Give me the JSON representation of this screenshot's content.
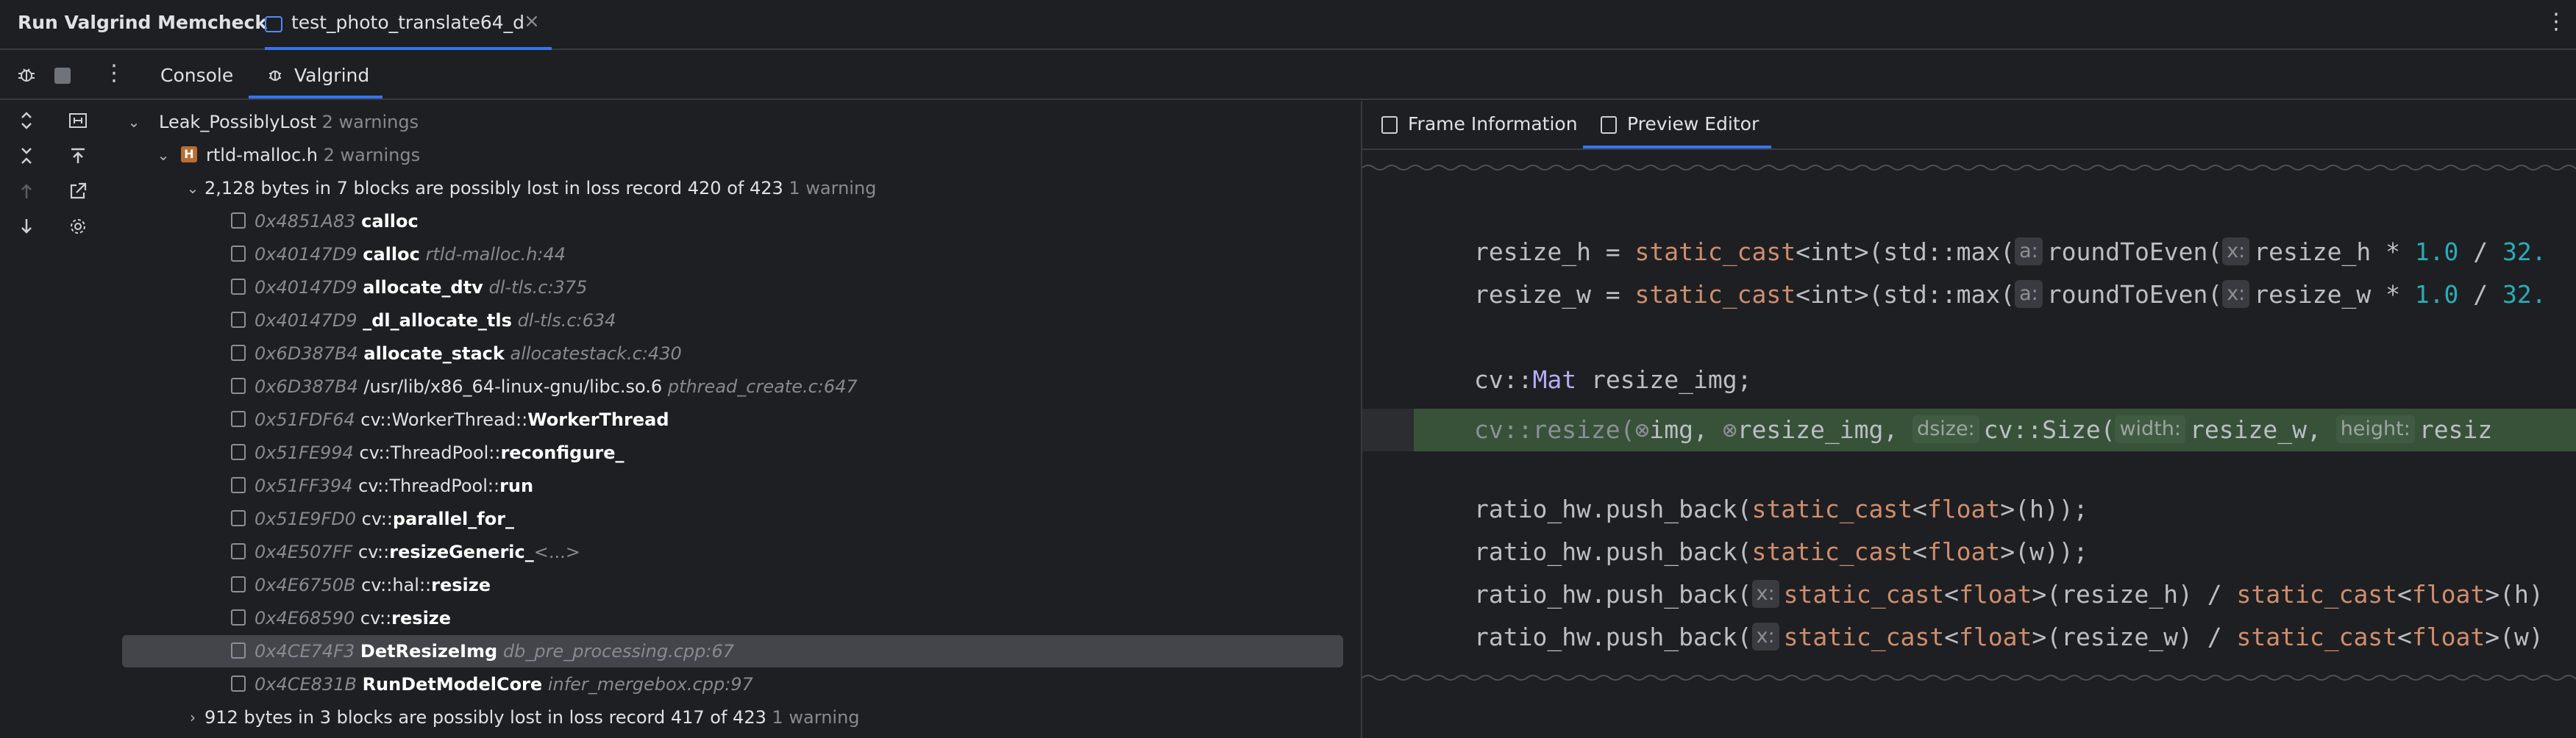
{
  "header": {
    "run_title": "Run Valgrind Memcheck",
    "file_tab": "test_photo_translate64_d",
    "close": "×",
    "more": "⋮"
  },
  "toolbar": {
    "console_tab": "Console",
    "valgrind_tab": "Valgrind",
    "more": "⋮"
  },
  "tree": {
    "leak": {
      "label": "Leak_PossiblyLost",
      "count": "2 warnings"
    },
    "file": {
      "label": "rtld-malloc.h",
      "count": "2 warnings"
    },
    "record1": {
      "label": "2,128 bytes in 7 blocks are possibly lost in loss record 420 of 423",
      "count": "1 warning"
    },
    "frames": [
      {
        "addr": "0x4851A83",
        "pre": "",
        "fn": "calloc",
        "post": "",
        "loc": ""
      },
      {
        "addr": "0x40147D9",
        "pre": "",
        "fn": "calloc",
        "post": "",
        "loc": "rtld-malloc.h:44"
      },
      {
        "addr": "0x40147D9",
        "pre": "",
        "fn": "allocate_dtv",
        "post": "",
        "loc": "dl-tls.c:375"
      },
      {
        "addr": "0x40147D9",
        "pre": "",
        "fn": "_dl_allocate_tls",
        "post": "",
        "loc": "dl-tls.c:634"
      },
      {
        "addr": "0x6D387B4",
        "pre": "",
        "fn": "allocate_stack",
        "post": "",
        "loc": "allocatestack.c:430"
      },
      {
        "addr": "0x6D387B4",
        "pre": "/usr/lib/x86_64-linux-gnu/libc.so.6",
        "fn": "",
        "post": "",
        "loc": "pthread_create.c:647"
      },
      {
        "addr": "0x51FDF64",
        "pre": "cv::WorkerThread::",
        "fn": "WorkerThread",
        "post": "",
        "loc": ""
      },
      {
        "addr": "0x51FE994",
        "pre": "cv::ThreadPool::",
        "fn": "reconfigure_",
        "post": "",
        "loc": ""
      },
      {
        "addr": "0x51FF394",
        "pre": "cv::ThreadPool::",
        "fn": "run",
        "post": "",
        "loc": ""
      },
      {
        "addr": "0x51E9FD0",
        "pre": "cv::",
        "fn": "parallel_for_",
        "post": "",
        "loc": ""
      },
      {
        "addr": "0x4E507FF",
        "pre": "cv::",
        "fn": "resizeGeneric_",
        "post": "<...>",
        "loc": ""
      },
      {
        "addr": "0x4E6750B",
        "pre": "cv::hal::",
        "fn": "resize",
        "post": "",
        "loc": ""
      },
      {
        "addr": "0x4E68590",
        "pre": "cv::",
        "fn": "resize",
        "post": "",
        "loc": ""
      },
      {
        "addr": "0x4CE74F3",
        "pre": "",
        "fn": "DetResizeImg",
        "post": "",
        "loc": "db_pre_processing.cpp:67"
      },
      {
        "addr": "0x4CE831B",
        "pre": "",
        "fn": "RunDetModelCore",
        "post": "",
        "loc": "infer_mergebox.cpp:97"
      }
    ],
    "record2": {
      "label": "912 bytes in 3 blocks are possibly lost in loss record 417 of 423",
      "count": "1 warning"
    }
  },
  "right": {
    "frame_tab": "Frame Information",
    "preview_tab": "Preview Editor"
  },
  "code": {
    "l1": {
      "a": "resize_h = ",
      "b": "static_cast",
      "c": "<int>(std::max(",
      "h1": "a:",
      "d": "roundToEven(",
      "h2": "x:",
      "e": "resize_h * ",
      "n": "1.0",
      "f": " / ",
      "g": "32."
    },
    "l2": {
      "a": "resize_w = ",
      "b": "static_cast",
      "c": "<int>(std::max(",
      "h1": "a:",
      "d": "roundToEven(",
      "h2": "x:",
      "e": "resize_w * ",
      "n": "1.0",
      "f": " / ",
      "g": "32."
    },
    "l3": {
      "a": "cv::",
      "b": "Mat",
      "c": " resize_img;"
    },
    "l4": {
      "a": "cv::resize(",
      "i1": "⊗",
      "b": "img, ",
      "i2": "⊗",
      "c": "resize_img, ",
      "h1": "dsize:",
      "d": "cv::Size(",
      "h2": "width:",
      "e": "resize_w, ",
      "h3": "height:",
      "f": "resiz"
    },
    "l5": {
      "a": "ratio_hw.push_back(",
      "b": "static_cast",
      "c": "<",
      "d": "float",
      "e": ">(h));"
    },
    "l6": {
      "a": "ratio_hw.push_back(",
      "b": "static_cast",
      "c": "<",
      "d": "float",
      "e": ">(w));"
    },
    "l7": {
      "a": "ratio_hw.push_back(",
      "h": "x:",
      "b": "static_cast",
      "c": "<",
      "d": "float",
      "e": ">(resize_h) / ",
      "f": "static_cast",
      "g": "<",
      "k": "float",
      "m": ">(h)"
    },
    "l8": {
      "a": "ratio_hw.push_back(",
      "h": "x:",
      "b": "static_cast",
      "c": "<",
      "d": "float",
      "e": ">(resize_w) / ",
      "f": "static_cast",
      "g": "<",
      "k": "float",
      "m": ">(w)"
    }
  }
}
